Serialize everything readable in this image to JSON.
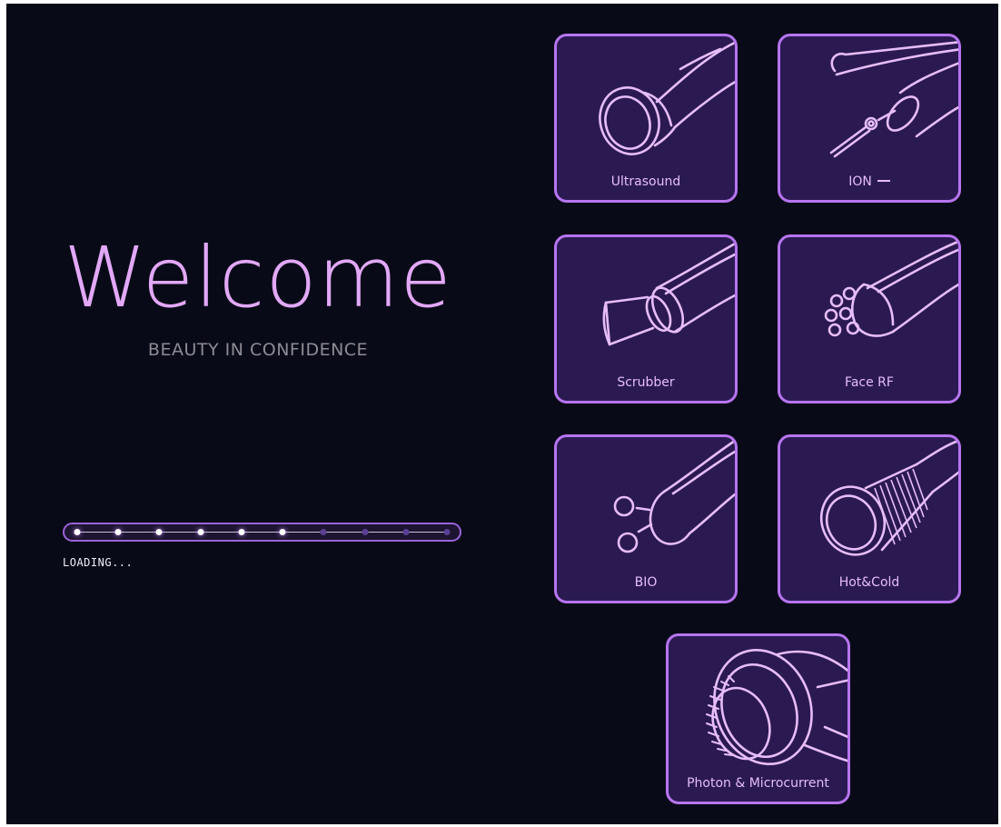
{
  "welcome": {
    "title": "Welcome",
    "tagline": "BEAUTY IN CONFIDENCE"
  },
  "loading": {
    "label": "LOADING...",
    "total_steps": 10,
    "completed_steps": 6
  },
  "colors": {
    "background": "#090a17",
    "accent": "#b675ef",
    "tile_fill": "#2b1a52",
    "text": "#e7bdf8"
  },
  "tiles": [
    {
      "label": "Ultrasound",
      "icon": "ultrasound-probe-icon"
    },
    {
      "label": "ION",
      "icon": "ion-pen-icon"
    },
    {
      "label": "Scrubber",
      "icon": "scrubber-paddle-icon"
    },
    {
      "label": "Face RF",
      "icon": "face-rf-probe-icon"
    },
    {
      "label": "BIO",
      "icon": "bio-double-ball-icon"
    },
    {
      "label": "Hot&Cold",
      "icon": "hot-cold-hammer-icon"
    },
    {
      "label": "Photon & Microcurrent",
      "icon": "photon-microcurrent-brush-icon"
    }
  ]
}
